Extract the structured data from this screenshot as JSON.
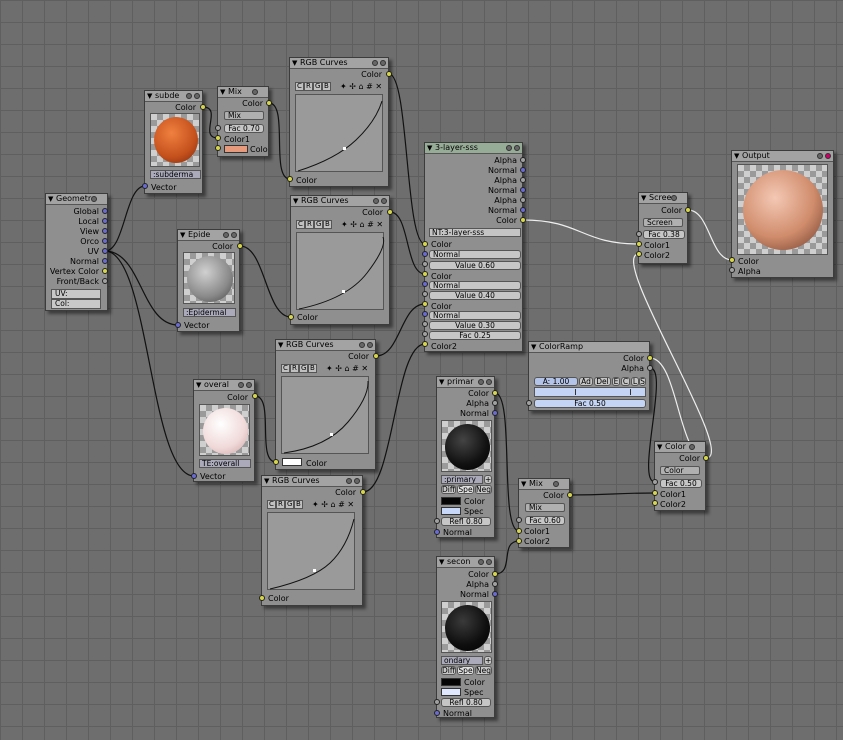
{
  "node_titles": {
    "geometry": "Geometr",
    "subdermal": "subde",
    "mix1": "Mix",
    "curves1": "RGB Curves",
    "epidermal": "Epide",
    "curves2": "RGB Curves",
    "sss": "3-layer-sss",
    "screen": "Scree",
    "output": "Output",
    "overall": "overal",
    "curves3": "RGB Curves",
    "curves4": "RGB Curves",
    "colorramp": "ColorRamp",
    "primary": "primar",
    "mix2": "Mix",
    "color_mix": "Color",
    "secondary": "secon"
  },
  "geometry": {
    "outputs": [
      "Global",
      "Local",
      "View",
      "Orco",
      "UV",
      "Normal",
      "Vertex Color",
      "Front/Back"
    ],
    "uv_field": "UV:",
    "col_field": "Col:"
  },
  "subdermal": {
    "out": "Color",
    "texname": ":subderma",
    "vector": "Vector"
  },
  "mix1": {
    "out": "Color",
    "mode": "Mix",
    "fac": "Fac 0.70",
    "color1": "Color1",
    "color2": "Colo",
    "swatch": "#e89a7c"
  },
  "curves": {
    "out": "Color",
    "in": "Color",
    "btns": [
      "C",
      "R",
      "G",
      "B"
    ],
    "tools": "✦ ✢ ⌂ # ✕"
  },
  "epidermal": {
    "out": "Color",
    "texname": ":Epidermal",
    "vector": "Vector"
  },
  "overall": {
    "out": "Color",
    "texname": "TE:overall",
    "vector": "Vector"
  },
  "sss": {
    "outputs": [
      "Alpha",
      "Normal",
      "Alpha",
      "Normal",
      "Alpha",
      "Normal",
      "Color"
    ],
    "nt": "NT:3-layer-sss",
    "inputs": [
      "Color",
      "Normal",
      "Value 0.60",
      "Color",
      "Normal",
      "Value 0.40",
      "Color",
      "Normal",
      "Value 0.30",
      "Fac 0.25",
      "Color2"
    ]
  },
  "screen": {
    "out": "Color",
    "mode": "Screen",
    "fac": "Fac 0.38",
    "color1": "Color1",
    "color2": "Color2"
  },
  "output": {
    "color": "Color",
    "alpha": "Alpha"
  },
  "colorramp": {
    "out_color": "Color",
    "out_alpha": "Alpha",
    "a_field": "A: 1.00",
    "add": "Ad",
    "del": "Del",
    "e": "E",
    "c": "C",
    "l": "L",
    "s": "S",
    "fac": "Fac 0.50"
  },
  "primary": {
    "outs": [
      "Color",
      "Alpha",
      "Normal"
    ],
    "matname": ":primary",
    "plus": "+",
    "diff": "Diff",
    "spec_b": "Spe",
    "neg": "Neg",
    "color": "Color",
    "spec": "Spec",
    "refl": "Refl 0.80",
    "normal": "Normal"
  },
  "mix2": {
    "out": "Color",
    "mode": "Mix",
    "fac": "Fac 0.60",
    "color1": "Color1",
    "color2": "Color2"
  },
  "color_mix": {
    "out": "Color",
    "mode": "Color",
    "fac": "Fac 0.50",
    "color1": "Color1",
    "color2": "Color2"
  },
  "secondary": {
    "outs": [
      "Color",
      "Alpha",
      "Normal"
    ],
    "matname": "ondary",
    "plus": "+",
    "diff": "Diff",
    "spec_b": "Spe",
    "neg": "Neg",
    "color": "Color",
    "spec": "Spec",
    "refl": "Refl 0.80",
    "normal": "Normal"
  },
  "colors": {
    "background": "#6e6e6e",
    "node_body": "#8f8f8f",
    "socket_color": "#d6d64a",
    "socket_vector": "#6a6ad0",
    "socket_value": "#a0a0a0",
    "group_header": "#97ac97"
  }
}
